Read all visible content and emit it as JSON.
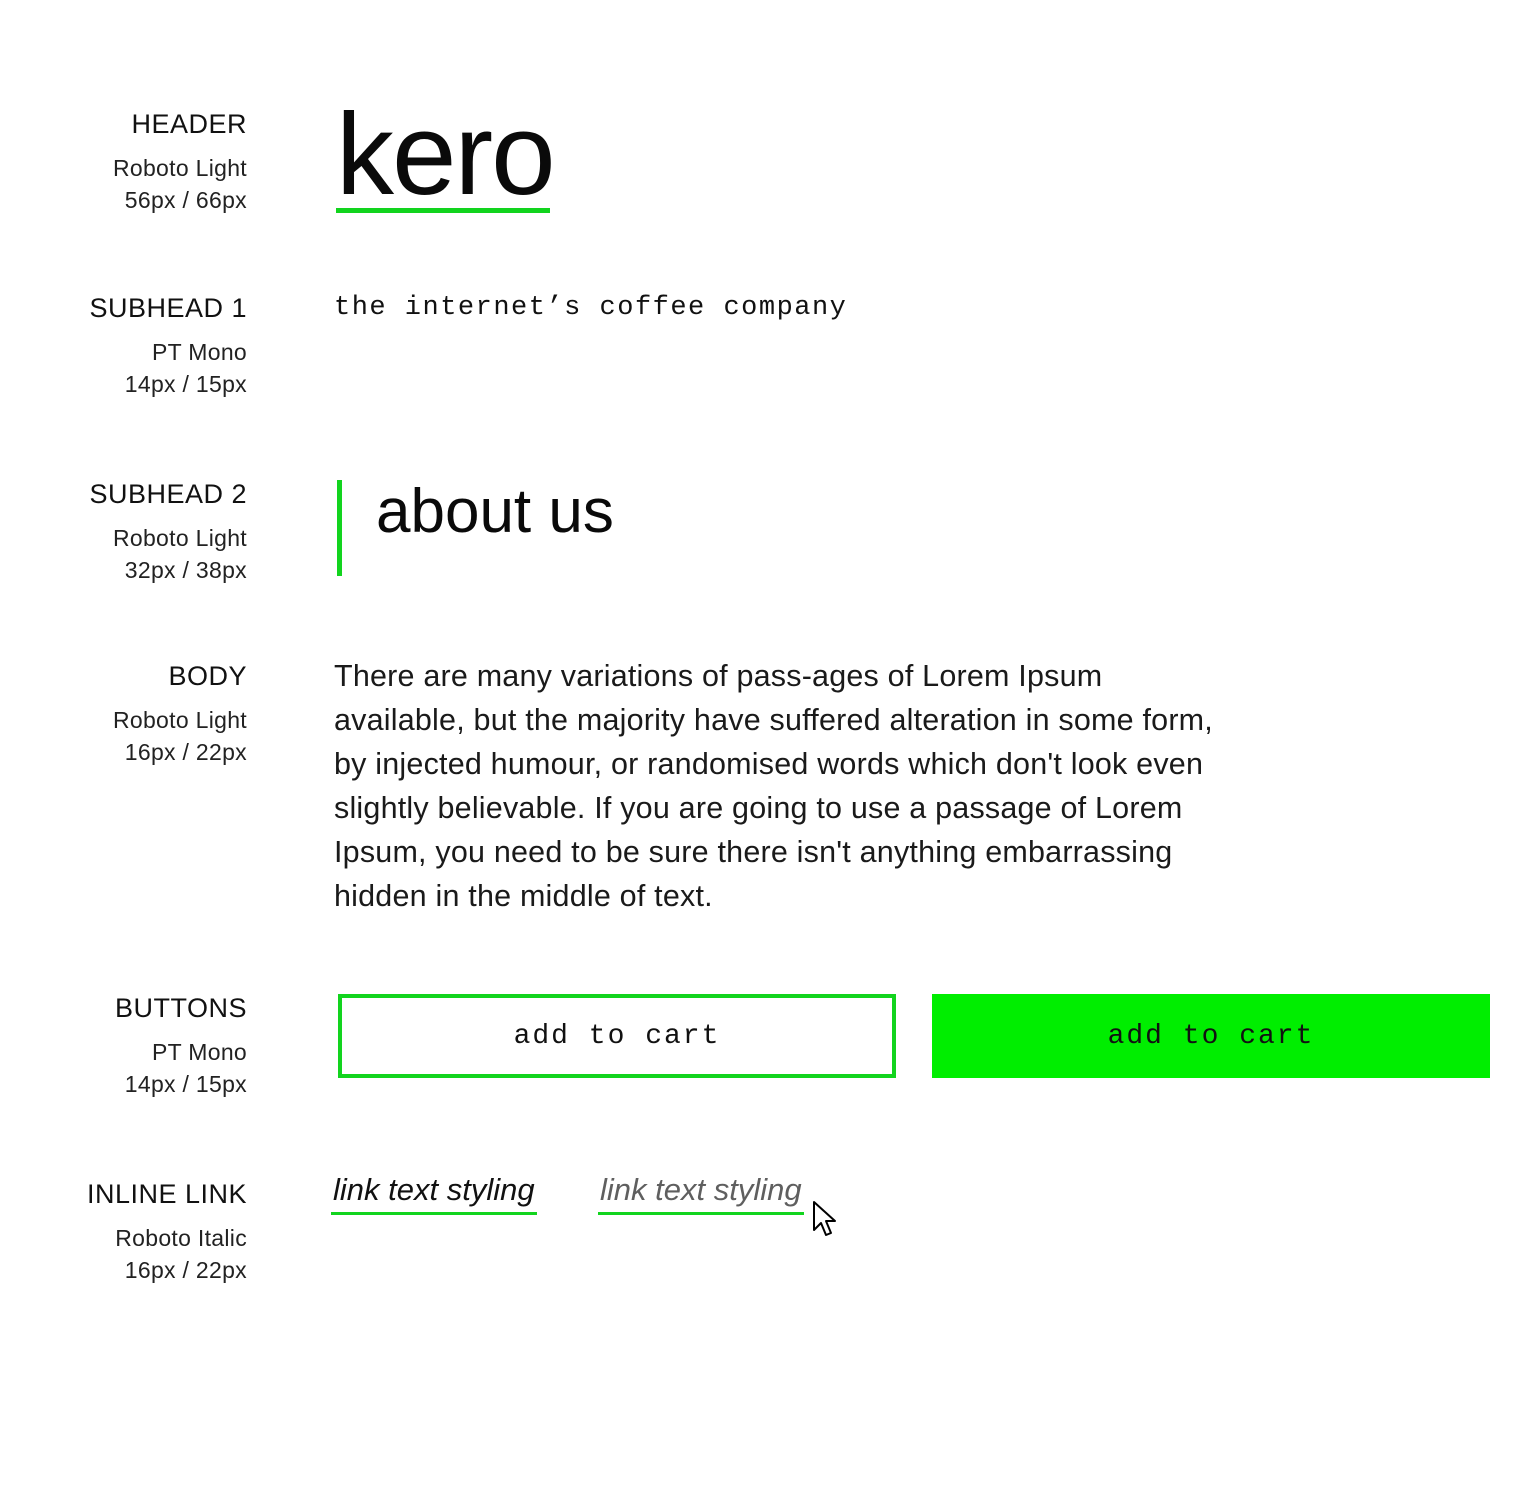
{
  "specs": {
    "header": {
      "name": "HEADER",
      "font": "Roboto Light",
      "size": "56px / 66px"
    },
    "subhead1": {
      "name": "SUBHEAD 1",
      "font": "PT Mono",
      "size": "14px / 15px"
    },
    "subhead2": {
      "name": "SUBHEAD 2",
      "font": "Roboto Light",
      "size": "32px / 38px"
    },
    "body": {
      "name": "BODY",
      "font": "Roboto Light",
      "size": "16px / 22px"
    },
    "buttons": {
      "name": "BUTTONS",
      "font": "PT Mono",
      "size": "14px / 15px"
    },
    "link": {
      "name": "INLINE LINK",
      "font": "Roboto Italic",
      "size": "16px / 22px"
    }
  },
  "samples": {
    "logo": "kero",
    "tagline": "the internet’s coffee company",
    "about": "about us",
    "body": "There are many variations of pass-ages of Lorem Ipsum available, but the majority have suffered alteration in some form, by injected humour, or randomised words which don't look even slightly believable. If you are going to use a passage of Lorem Ipsum, you need to be sure there isn't anything embarrassing hidden in the middle of text.",
    "button_outline": "add to cart",
    "button_filled": "add to cart",
    "link_default": "link text styling",
    "link_hover": "link text styling"
  },
  "colors": {
    "accent": "#12d41e",
    "button_fill": "#00ee00",
    "text": "#111111",
    "link_hover_text": "#5f5f5f"
  },
  "icons": {
    "cursor": "arrow-pointer-icon"
  }
}
